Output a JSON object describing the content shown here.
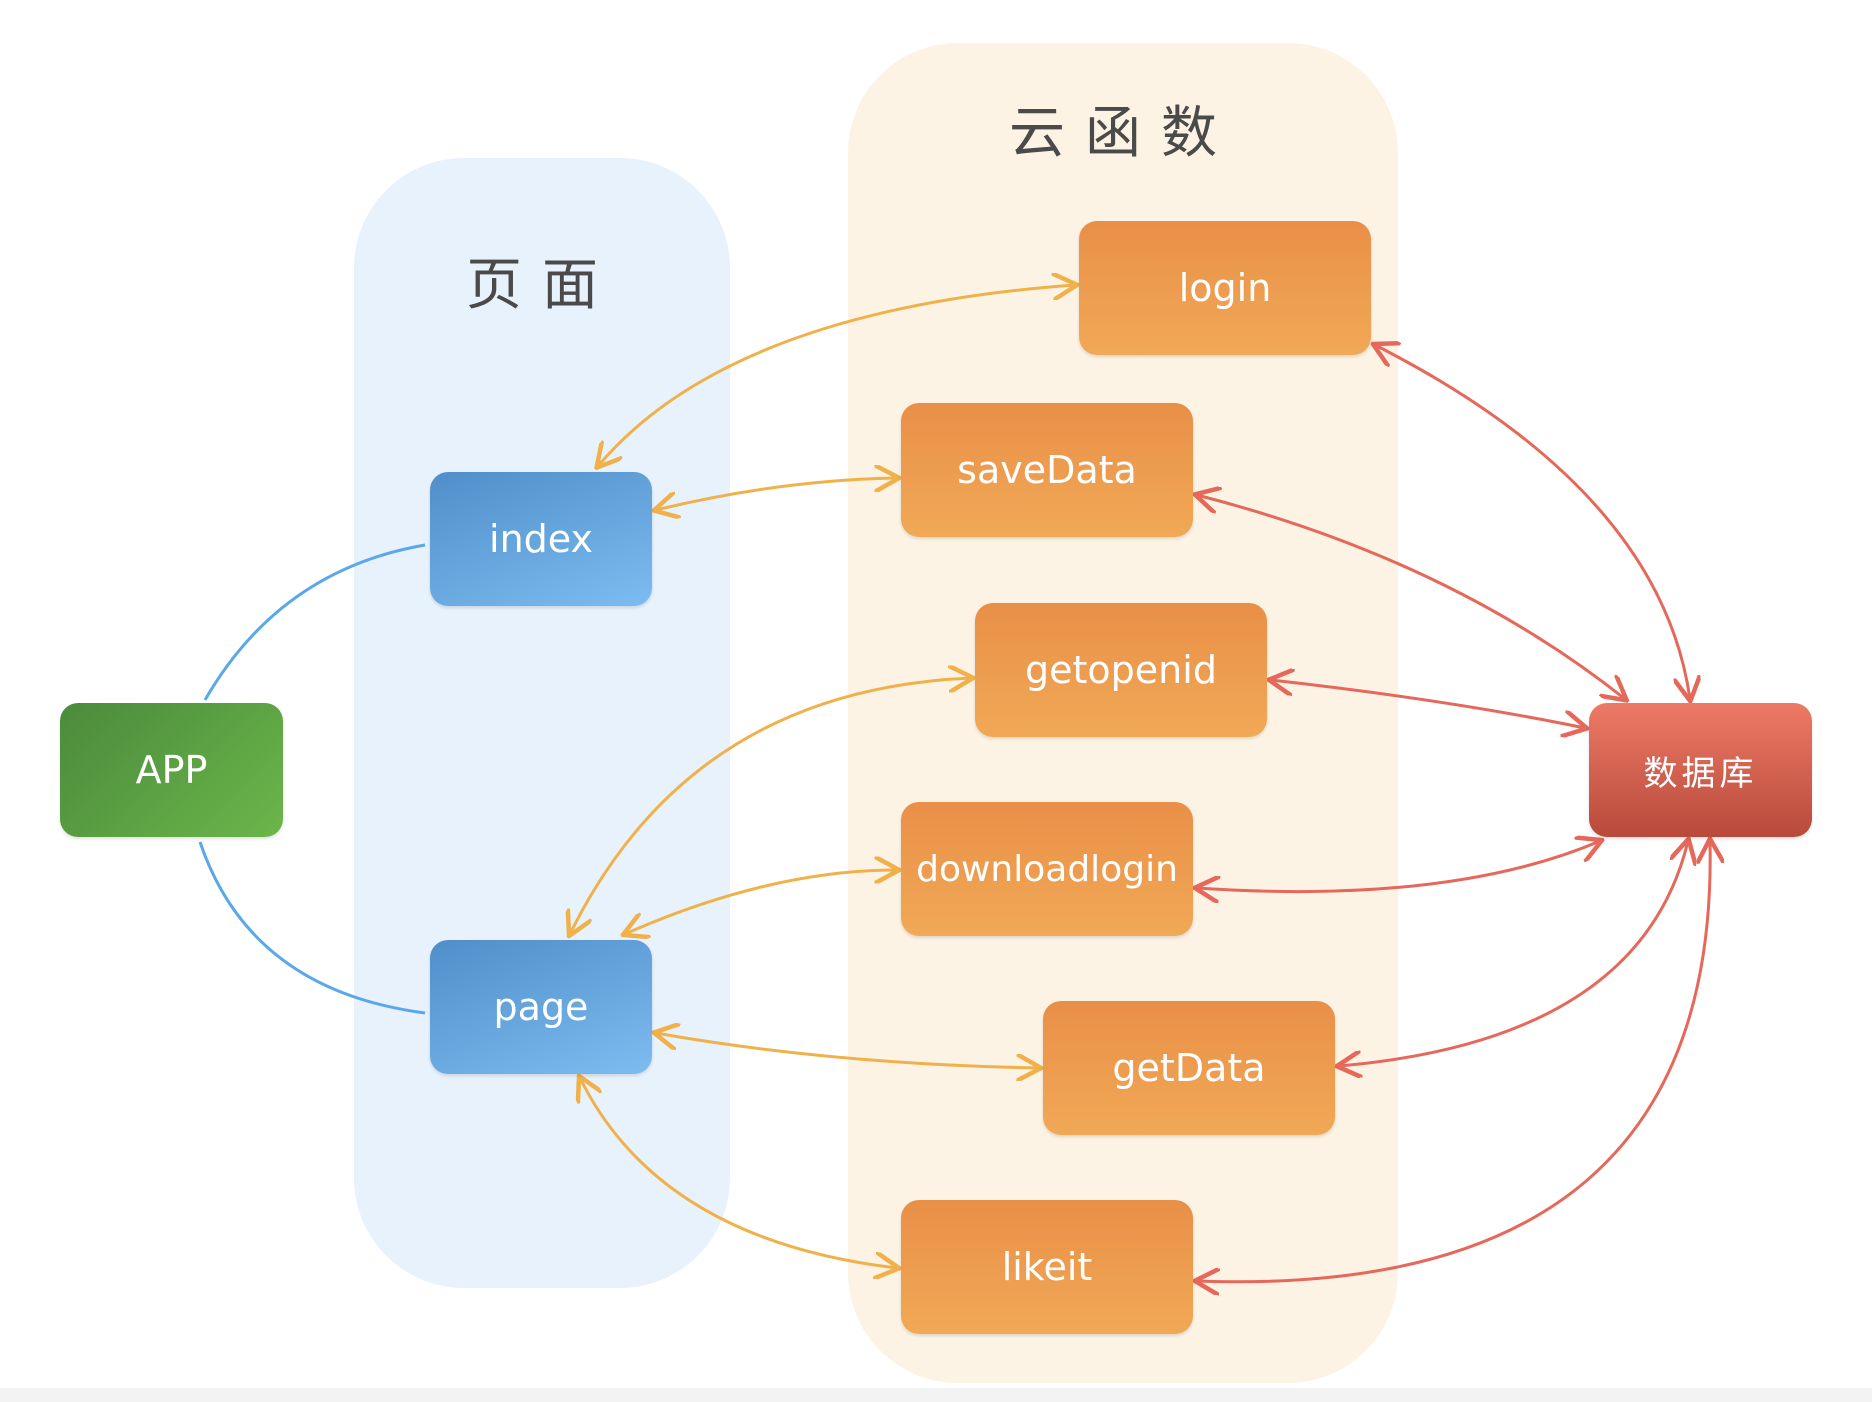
{
  "groups": {
    "pages_title": "页面",
    "cloud_functions_title": "云函数"
  },
  "nodes": {
    "app": "APP",
    "index": "index",
    "page": "page",
    "login": "login",
    "savedata": "saveData",
    "getopenid": "getopenid",
    "downloadlogin": "downloadlogin",
    "getdata": "getData",
    "likeit": "likeit",
    "database": "数据库"
  },
  "colors": {
    "app_node": "#5a9e43",
    "page_node": "#5e9fdb",
    "cloud_function_node": "#ec9a4f",
    "database_node": "#d45f4e",
    "page_link": "#5aa8ea",
    "function_link": "#f0b14a",
    "database_link": "#e5685a"
  }
}
